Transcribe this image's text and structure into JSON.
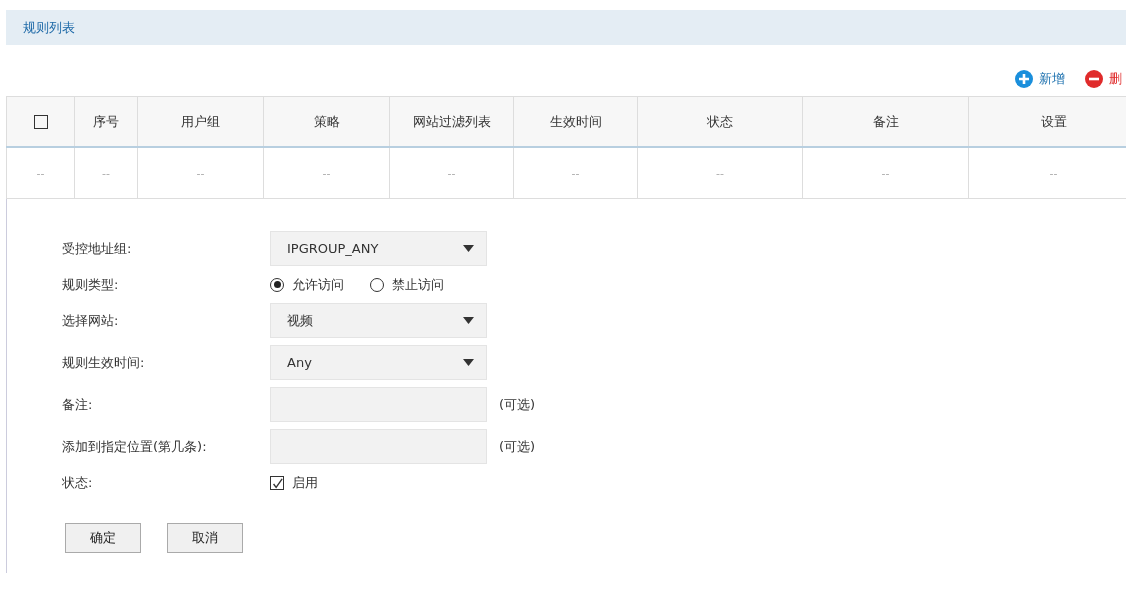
{
  "section_title": "规则列表",
  "toolbar": [
    {
      "kind": "add",
      "label": "新增"
    },
    {
      "kind": "delete",
      "label": "删"
    }
  ],
  "table": {
    "select_all": {
      "checked": false
    },
    "columns": [
      "序号",
      "用户组",
      "策略",
      "网站过滤列表",
      "生效时间",
      "状态",
      "备注",
      "设置"
    ],
    "rows": [
      {
        "select": "--",
        "cells": [
          "--",
          "--",
          "--",
          "--",
          "--",
          "--",
          "--",
          "--"
        ]
      }
    ]
  },
  "form": {
    "fields": [
      {
        "kind": "select",
        "label": "受控地址组:",
        "value": "IPGROUP_ANY"
      },
      {
        "kind": "radio",
        "label": "规则类型:",
        "options": [
          {
            "label": "允许访问",
            "selected": true
          },
          {
            "label": "禁止访问",
            "selected": false
          }
        ]
      },
      {
        "kind": "select",
        "label": "选择网站:",
        "value": "视频"
      },
      {
        "kind": "select",
        "label": "规则生效时间:",
        "value": "Any"
      },
      {
        "kind": "input",
        "label": "备注:",
        "note": "(可选)"
      },
      {
        "kind": "input",
        "label": "添加到指定位置(第几条):",
        "note": "(可选)"
      },
      {
        "kind": "checkbox",
        "label": "状态:",
        "option": "启用",
        "checked": true
      }
    ],
    "buttons": [
      "确定",
      "取消"
    ]
  }
}
